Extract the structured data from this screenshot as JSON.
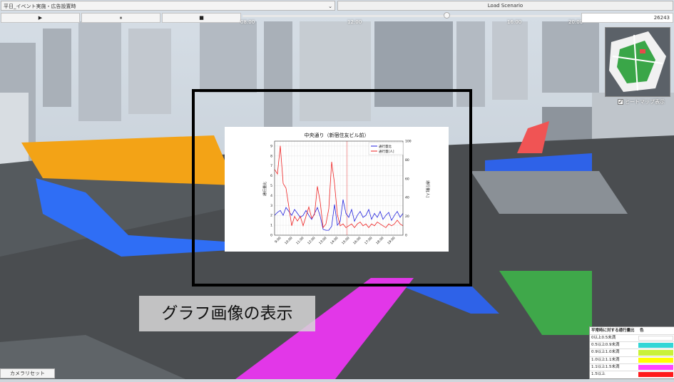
{
  "toolbar": {
    "scenario_value": "平日_イベント実施・広告設置時",
    "load_label": "Load Scenario",
    "play_icon": "▶",
    "pause_icon": "⏸",
    "stop_icon": "■",
    "frame_count": "26243"
  },
  "timeline": {
    "ticks": [
      "08:00",
      "12:00",
      "16:00",
      "20:00"
    ],
    "progress": 0.59
  },
  "map": {
    "heatmap_label": "ヒートマップ表示",
    "heatmap_checked": true
  },
  "caption": "グラフ画像の表示",
  "camera_reset_label": "カメラリセット",
  "legend": {
    "header_label": "平常時に対する通行量比",
    "header_color": "色",
    "rows": [
      {
        "label": "0以上0.5未満",
        "color": "#ffffff"
      },
      {
        "label": "0.5以上0.9未満",
        "color": "#33d6d6"
      },
      {
        "label": "0.9以上1.0未満",
        "color": "#c9f23a"
      },
      {
        "label": "1.0以上1.1未満",
        "color": "#ffff00"
      },
      {
        "label": "1.1以上1.5未満",
        "color": "#ff44ff"
      },
      {
        "label": "1.5以上",
        "color": "#ff1a1a"
      }
    ]
  },
  "chart_data": {
    "type": "line",
    "title": "中央通り（新宿住友ビル前）",
    "ylabel_left": "通行量比",
    "ylabel_right": "通行量[人]",
    "ylim_left": [
      0,
      9.5
    ],
    "yticks_left": [
      "0",
      "1",
      "2",
      "3",
      "4",
      "5",
      "6",
      "7",
      "8",
      "9"
    ],
    "ylim_right": [
      0,
      100
    ],
    "yticks_right": [
      "0",
      "20",
      "40",
      "60",
      "80",
      "100"
    ],
    "x_ticks": [
      "9:00",
      "10:00",
      "11:00",
      "12:00",
      "13:00",
      "14:00",
      "15:00",
      "16:00",
      "17:00",
      "18:00",
      "19:00"
    ],
    "x_range": [
      8.5,
      19.75
    ],
    "vline_x": 14.85,
    "legend": [
      "通行量比",
      "通行量[人]"
    ],
    "series": [
      {
        "name": "通行量比",
        "color": "#2222dd",
        "x": [
          8.5,
          8.75,
          9.0,
          9.25,
          9.5,
          9.75,
          10.0,
          10.25,
          10.5,
          10.75,
          11.0,
          11.25,
          11.5,
          11.75,
          12.0,
          12.25,
          12.5,
          12.75,
          13.0,
          13.25,
          13.5,
          13.75,
          14.0,
          14.25,
          14.5,
          14.75,
          15.0,
          15.25,
          15.5,
          15.75,
          16.0,
          16.25,
          16.5,
          16.75,
          17.0,
          17.25,
          17.5,
          17.75,
          18.0,
          18.25,
          18.5,
          18.75,
          19.0,
          19.25,
          19.5,
          19.75
        ],
        "values": [
          2.0,
          2.3,
          2.5,
          2.0,
          2.8,
          2.4,
          2.0,
          2.6,
          2.2,
          1.8,
          2.0,
          2.5,
          2.0,
          1.6,
          2.2,
          2.8,
          1.9,
          0.6,
          0.5,
          0.5,
          0.9,
          3.1,
          1.0,
          1.4,
          3.6,
          2.2,
          1.8,
          2.6,
          1.4,
          2.0,
          2.4,
          1.8,
          2.0,
          2.6,
          1.6,
          2.2,
          1.8,
          2.4,
          1.6,
          2.0,
          2.3,
          1.5,
          2.0,
          2.4,
          1.8,
          2.2
        ]
      },
      {
        "name": "通行量[人]",
        "color": "#ee2222",
        "x": [
          8.5,
          8.75,
          9.0,
          9.25,
          9.5,
          9.75,
          10.0,
          10.25,
          10.5,
          10.75,
          11.0,
          11.25,
          11.5,
          11.75,
          12.0,
          12.25,
          12.5,
          12.75,
          13.0,
          13.25,
          13.5,
          13.75,
          14.0,
          14.25,
          14.5,
          14.75,
          15.0,
          15.25,
          15.5,
          15.75,
          16.0,
          16.25,
          16.5,
          16.75,
          17.0,
          17.25,
          17.5,
          17.75,
          18.0,
          18.25,
          18.5,
          18.75,
          19.0,
          19.25,
          19.5,
          19.75
        ],
        "values": [
          70,
          65,
          95,
          55,
          50,
          30,
          10,
          20,
          15,
          20,
          10,
          20,
          30,
          18,
          22,
          52,
          35,
          8,
          12,
          28,
          78,
          55,
          22,
          10,
          12,
          8,
          10,
          12,
          8,
          12,
          14,
          10,
          12,
          8,
          12,
          10,
          14,
          12,
          10,
          8,
          12,
          10,
          12,
          16,
          12,
          10
        ]
      }
    ]
  }
}
